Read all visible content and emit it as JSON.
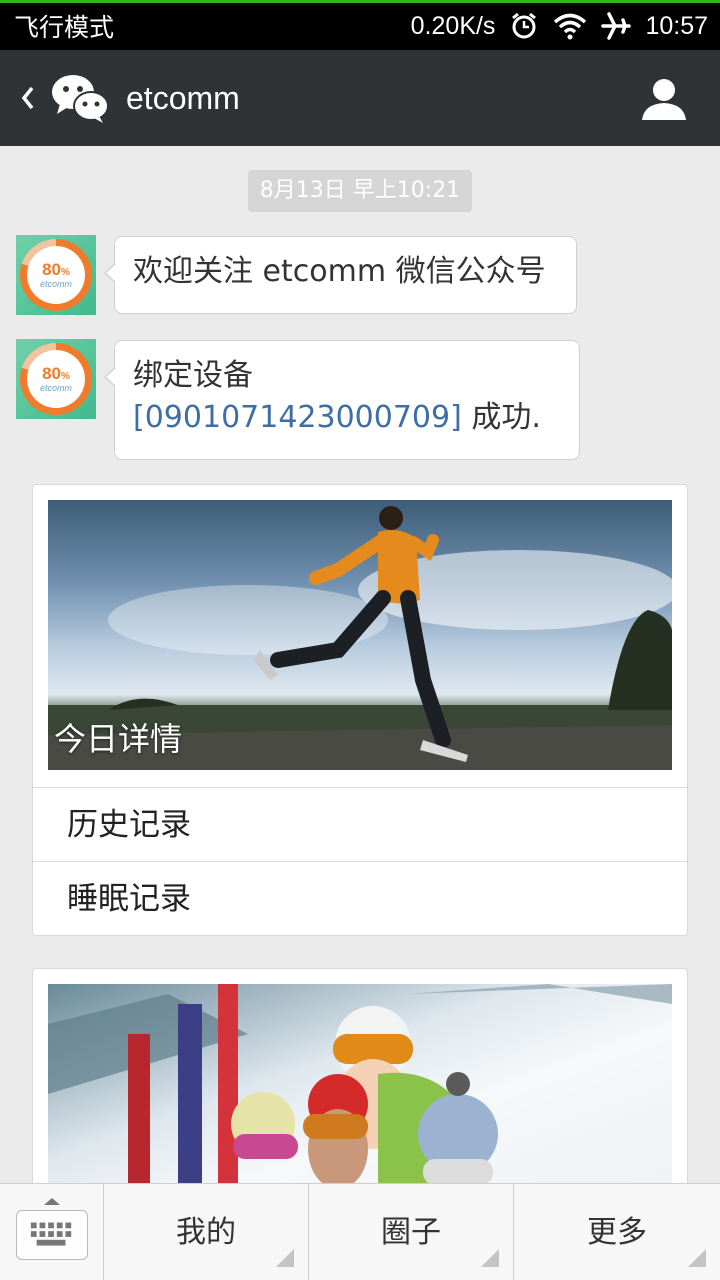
{
  "status_bar": {
    "left_text": "飞行模式",
    "speed": "0.20K/s",
    "time": "10:57",
    "icons": [
      "alarm-icon",
      "wifi-icon",
      "airplane-icon"
    ]
  },
  "header": {
    "title": "etcomm",
    "icons": [
      "back-icon",
      "wechat-icon",
      "profile-icon"
    ]
  },
  "chat": {
    "timestamp": "8月13日 早上10:21",
    "avatar": {
      "value": "80",
      "unit": "%",
      "brand": "etcomm"
    },
    "messages": [
      {
        "text": "欢迎关注 etcomm 微信公众号"
      },
      {
        "line1": "绑定设备",
        "link_prefix": "[",
        "device_id": "0901071423000709",
        "link_suffix": "]",
        "suffix": " 成功."
      }
    ]
  },
  "article_card": {
    "cover_caption": "今日详情",
    "items": [
      "历史记录",
      "睡眠记录"
    ]
  },
  "bottom_bar": {
    "keyboard_icon": "keyboard-icon",
    "menus": [
      "我的",
      "圈子",
      "更多"
    ]
  },
  "colors": {
    "header_bg": "#2f3335",
    "chat_bg": "#ebebeb",
    "link": "#3d6ea5",
    "status_accent": "#35b31c",
    "avatar_ring": "#f07b2a"
  }
}
